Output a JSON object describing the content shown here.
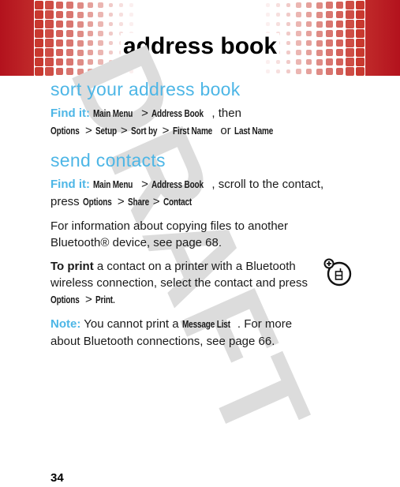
{
  "header": {
    "title": "address book",
    "colors": {
      "bar": "#b3121d",
      "square": "#c8382f"
    }
  },
  "watermark": "DRAFT",
  "sections": [
    {
      "heading": "sort your address book",
      "find_it_label": "Find it:",
      "path": {
        "k1": "Main Menu",
        "sep": ">",
        "k2": "Address Book",
        "t1": ", then",
        "k3": "Options",
        "k4": "Setup",
        "k5": "Sort by",
        "k6": "First Name",
        "t2": "or",
        "k7": "Last Name"
      }
    },
    {
      "heading": "send contacts",
      "find_it_label": "Find it:",
      "path": {
        "k1": "Main Menu",
        "sep": ">",
        "k2": "Address Book",
        "t1": ", scroll to the contact,",
        "t2": "press",
        "k3": "Options",
        "k4": "Share",
        "k5": "Contact"
      },
      "para1": "For information about copying files to another Bluetooth® device, see page 68.",
      "print": {
        "lead": "To print",
        "text": " a contact on a printer with a Bluetooth wireless connection, select the contact and press ",
        "k1": "Options",
        "k2": "Print",
        "end": "."
      },
      "note": {
        "label": "Note:",
        "t1": " You cannot print a ",
        "k1": "Message List",
        "t2": ". For more about Bluetooth connections, see page 66."
      }
    }
  ],
  "side_icon": "bluetooth-phone-feature-icon",
  "page_number": "34",
  "colors": {
    "heading": "#4db6e6",
    "text": "#1a1a1a",
    "watermark": "#dcdcdc"
  }
}
